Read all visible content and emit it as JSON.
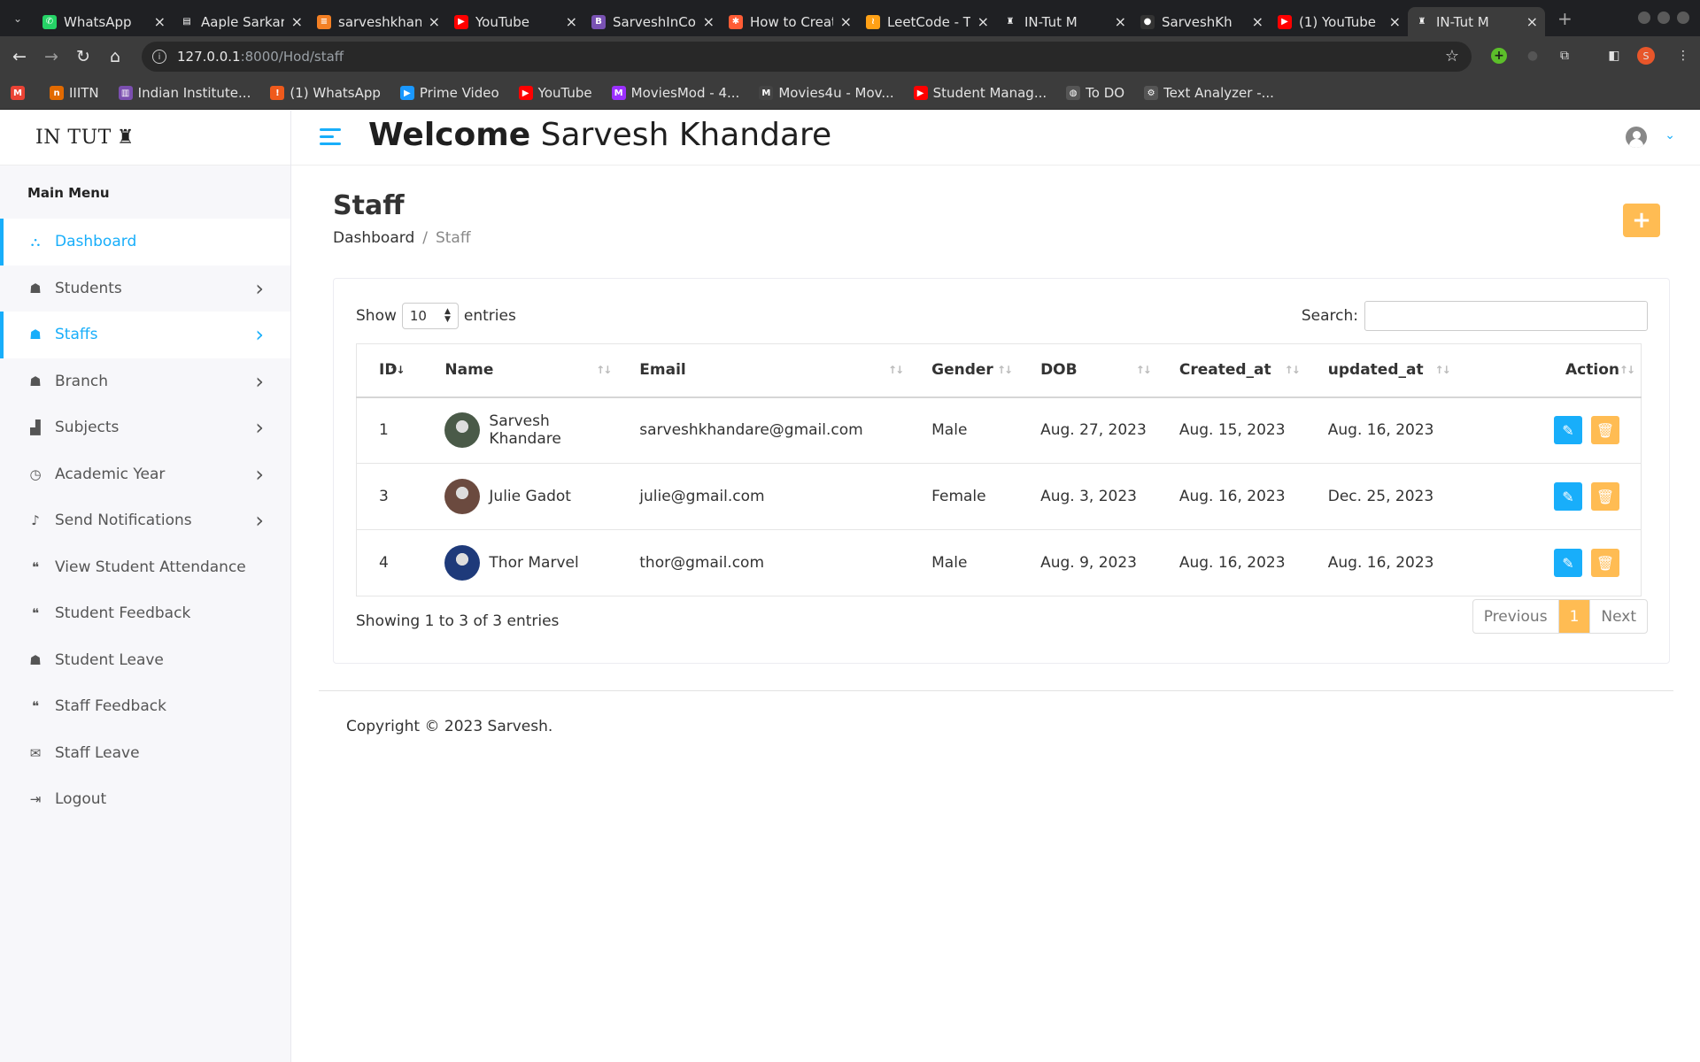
{
  "browser": {
    "tabs": [
      {
        "title": "WhatsApp",
        "icon": "whatsapp-icon",
        "color": "#25d366",
        "glyph": "✆"
      },
      {
        "title": "Aaple Sarkar",
        "icon": "document-icon",
        "color": "#ffffff",
        "glyph": "▤"
      },
      {
        "title": "sarveshkhandare",
        "icon": "stack-icon",
        "color": "#f48024",
        "glyph": "≡"
      },
      {
        "title": "YouTube",
        "icon": "youtube-icon",
        "color": "#ff0000",
        "glyph": "▶"
      },
      {
        "title": "SarveshInCode",
        "icon": "bootstrap-icon",
        "color": "#7952b3",
        "glyph": "B"
      },
      {
        "title": "How to Create",
        "icon": "hubspot-icon",
        "color": "#ff5c35",
        "glyph": "✱"
      },
      {
        "title": "LeetCode - The",
        "icon": "leetcode-icon",
        "color": "#ffa116",
        "glyph": "≀"
      },
      {
        "title": "IN-Tut M",
        "icon": "intut-icon",
        "color": "#ffffff",
        "glyph": "♜"
      },
      {
        "title": "SarveshKh",
        "icon": "github-icon",
        "color": "#333333",
        "glyph": "●"
      },
      {
        "title": "(1) YouTube",
        "icon": "youtube-icon",
        "color": "#ff0000",
        "glyph": "▶"
      },
      {
        "title": "IN-Tut M",
        "icon": "intut-icon",
        "color": "#ffffff",
        "glyph": "♜"
      }
    ],
    "url_host": "127.0.0.1",
    "url_path": ":8000/Hod/staff",
    "bookmarks": [
      {
        "title": "",
        "icon": "gmail-icon",
        "color": "#ea4335",
        "glyph": "M"
      },
      {
        "title": "IIITN",
        "icon": "iiitn-icon",
        "color": "#e26a00",
        "glyph": "n"
      },
      {
        "title": "Indian Institute...",
        "icon": "institute-icon",
        "color": "#7b4fb0",
        "glyph": "▥"
      },
      {
        "title": "(1) WhatsApp",
        "icon": "whatsapp-icon",
        "color": "#ef5a1c",
        "glyph": "!"
      },
      {
        "title": "Prime Video",
        "icon": "prime-video-icon",
        "color": "#1a98ff",
        "glyph": "▶"
      },
      {
        "title": "YouTube",
        "icon": "youtube-icon",
        "color": "#ff0000",
        "glyph": "▶"
      },
      {
        "title": "MoviesMod - 4...",
        "icon": "moviesmod-icon",
        "color": "#9b30ff",
        "glyph": "M"
      },
      {
        "title": "Movies4u - Mov...",
        "icon": "movies4u-icon",
        "color": "#444444",
        "glyph": "M"
      },
      {
        "title": "Student Manag...",
        "icon": "youtube-icon",
        "color": "#ff0000",
        "glyph": "▶"
      },
      {
        "title": "To DO",
        "icon": "globe-icon",
        "color": "#555555",
        "glyph": "◍"
      },
      {
        "title": "Text Analyzer -...",
        "icon": "gear-icon",
        "color": "#555555",
        "glyph": "⚙"
      }
    ],
    "profile_initial": "S"
  },
  "app": {
    "logo": "IN TUT",
    "welcome_bold": "Welcome",
    "welcome_name": "Sarvesh Khandare",
    "menu_title": "Main Menu",
    "sidebar": [
      {
        "label": "Dashboard",
        "icon": "dashboard-icon",
        "glyph": "⛬",
        "chevron": false,
        "active": true
      },
      {
        "label": "Students",
        "icon": "graduation-cap-icon",
        "glyph": "☗",
        "chevron": true,
        "active": false
      },
      {
        "label": "Staffs",
        "icon": "chalkboard-teacher-icon",
        "glyph": "☗",
        "chevron": true,
        "active": true
      },
      {
        "label": "Branch",
        "icon": "mortarboard-icon",
        "glyph": "☗",
        "chevron": true,
        "active": false
      },
      {
        "label": "Subjects",
        "icon": "subjects-icon",
        "glyph": "▟",
        "chevron": true,
        "active": false
      },
      {
        "label": "Academic Year",
        "icon": "clock-icon",
        "glyph": "◷",
        "chevron": true,
        "active": false
      },
      {
        "label": "Send Notifications",
        "icon": "bell-icon",
        "glyph": "♪",
        "chevron": true,
        "active": false
      },
      {
        "label": "View Student Attendance",
        "icon": "comments-icon",
        "glyph": "❝",
        "chevron": false,
        "active": false
      },
      {
        "label": "Student Feedback",
        "icon": "comments-icon",
        "glyph": "❝",
        "chevron": false,
        "active": false
      },
      {
        "label": "Student Leave",
        "icon": "graduation-cap-icon",
        "glyph": "☗",
        "chevron": false,
        "active": false
      },
      {
        "label": "Staff Feedback",
        "icon": "comments-icon",
        "glyph": "❝",
        "chevron": false,
        "active": false
      },
      {
        "label": "Staff Leave",
        "icon": "envelope-icon",
        "glyph": "✉",
        "chevron": false,
        "active": false
      },
      {
        "label": "Logout",
        "icon": "logout-icon",
        "glyph": "⇥",
        "chevron": false,
        "active": false
      }
    ],
    "page_title": "Staff",
    "breadcrumb": {
      "home": "Dashboard",
      "current": "Staff"
    },
    "add_button": "+",
    "table_controls": {
      "show_label": "Show",
      "entries_value": "10",
      "entries_label": "entries",
      "search_label": "Search:",
      "search_value": ""
    },
    "columns": [
      "ID",
      "Name",
      "Email",
      "Gender",
      "DOB",
      "Created_at",
      "updated_at",
      "Action"
    ],
    "rows": [
      {
        "id": "1",
        "name": "Sarvesh Khandare",
        "email": "sarveshkhandare@gmail.com",
        "gender": "Male",
        "dob": "Aug. 27, 2023",
        "created": "Aug. 15, 2023",
        "updated": "Aug. 16, 2023",
        "avatar_color": "#4a5a48"
      },
      {
        "id": "3",
        "name": "Julie Gadot",
        "email": "julie@gmail.com",
        "gender": "Female",
        "dob": "Aug. 3, 2023",
        "created": "Aug. 16, 2023",
        "updated": "Dec. 25, 2023",
        "avatar_color": "#6b4a3f"
      },
      {
        "id": "4",
        "name": "Thor Marvel",
        "email": "thor@gmail.com",
        "gender": "Male",
        "dob": "Aug. 9, 2023",
        "created": "Aug. 16, 2023",
        "updated": "Aug. 16, 2023",
        "avatar_color": "#1e3a7a"
      }
    ],
    "info": "Showing 1 to 3 of 3 entries",
    "pager": {
      "previous": "Previous",
      "current": "1",
      "next": "Next"
    },
    "footer": "Copyright © 2023 Sarvesh.",
    "colors": {
      "accent": "#18aefa",
      "warning": "#ffbc53"
    }
  }
}
